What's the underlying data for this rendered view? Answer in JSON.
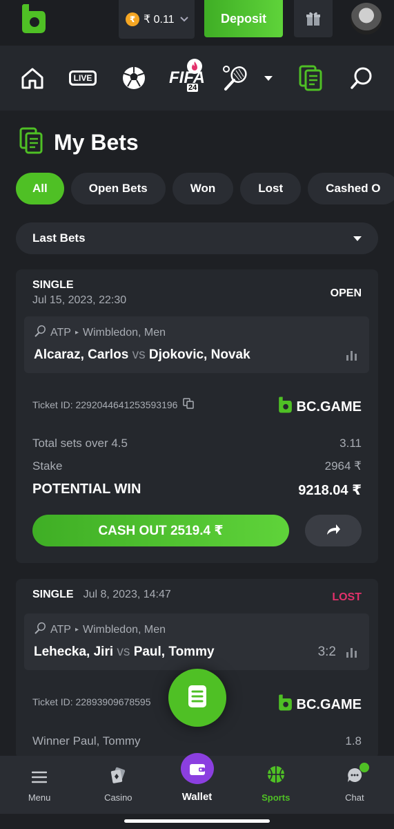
{
  "header": {
    "balance": "₹ 0.11",
    "currency_symbol": "₹",
    "deposit_label": "Deposit"
  },
  "sports_nav": {
    "live_label": "LIVE",
    "fifa_label": "FIFA",
    "fifa_badge": "24"
  },
  "page": {
    "title": "My Bets"
  },
  "filters": {
    "items": [
      "All",
      "Open Bets",
      "Won",
      "Lost",
      "Cashed O"
    ],
    "active": "All"
  },
  "period_select": {
    "value": "Last Bets"
  },
  "bets": [
    {
      "type": "SINGLE",
      "date": "Jul 15, 2023, 22:30",
      "status": "OPEN",
      "status_color": "#ffffff",
      "league": "ATP",
      "tournament": "Wimbledon, Men",
      "home": "Alcaraz, Carlos",
      "vs": "vs",
      "away": "Djokovic, Novak",
      "ticket_id": "Ticket ID: 2292044641253593196",
      "brand": "BC.GAME",
      "market": "Total sets over 4.5",
      "odds": "3.11",
      "stake_label": "Stake",
      "stake": "2964 ₹",
      "potential_label": "POTENTIAL WIN",
      "potential": "9218.04 ₹",
      "cashout_label": "CASH OUT 2519.4 ₹"
    },
    {
      "type": "SINGLE",
      "date": "Jul 8, 2023, 14:47",
      "status": "LOST",
      "status_color": "#e3316b",
      "league": "ATP",
      "tournament": "Wimbledon, Men",
      "home": "Lehecka, Jiri",
      "vs": "vs",
      "away": "Paul, Tommy",
      "score": "3:2",
      "ticket_id": "Ticket ID: 22893909678595",
      "brand": "BC.GAME",
      "market": "Winner Paul, Tommy",
      "odds": "1.8"
    }
  ],
  "bottom_nav": {
    "menu": "Menu",
    "casino": "Casino",
    "wallet": "Wallet",
    "sports": "Sports",
    "chat": "Chat"
  },
  "colors": {
    "accent": "#4fc025",
    "background": "#1e2024",
    "card": "#25282d",
    "lost": "#e3316b",
    "wallet": "#8b3fe0"
  }
}
